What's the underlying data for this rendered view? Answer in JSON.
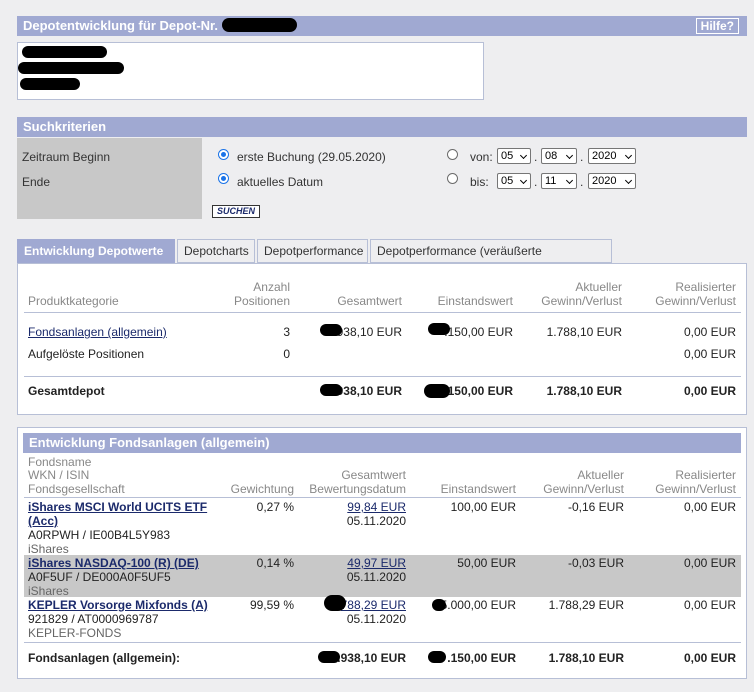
{
  "header": {
    "title": "Depotentwicklung für Depot-Nr.",
    "help_label": "Hilfe?"
  },
  "search": {
    "title": "Suchkriterien",
    "start_label": "Zeitraum Beginn",
    "end_label": "Ende",
    "opt_first_booking": "erste Buchung (29.05.2020)",
    "opt_current_date": "aktuelles Datum",
    "from_label": "von:",
    "to_label": "bis:",
    "from_day": "05",
    "from_month": "08",
    "from_year": "2020",
    "to_day": "05",
    "to_month": "11",
    "to_year": "2020",
    "dot": ".",
    "search_button": "SUCHEN"
  },
  "tabs": [
    "Entwicklung Depotwerte",
    "Depotcharts",
    "Depotperformance",
    "Depotperformance (veräußerte Positionen)"
  ],
  "summary": {
    "headers": {
      "category": "Produktkategorie",
      "count_l1": "Anzahl",
      "count_l2": "Positionen",
      "total": "Gesamtwert",
      "cost": "Einstandswert",
      "current_l1": "Aktueller",
      "current_l2": "Gewinn/Verlust",
      "realized_l1": "Realisierter",
      "realized_l2": "Gewinn/Verlust"
    },
    "rows": [
      {
        "category": "Fondsanlagen (allgemein)",
        "count": "3",
        "total": ".938,10 EUR",
        "cost": ".150,00 EUR",
        "current": "1.788,10 EUR",
        "realized": "0,00 EUR"
      },
      {
        "category": "Aufgelöste Positionen",
        "count": "0",
        "total": "",
        "cost": "",
        "current": "",
        "realized": "0,00 EUR"
      }
    ],
    "total_row": {
      "label": "Gesamtdepot",
      "total": ".938,10 EUR",
      "cost": ".150,00 EUR",
      "current": "1.788,10 EUR",
      "realized": "0,00 EUR"
    }
  },
  "funds": {
    "title": "Entwicklung Fondsanlagen (allgemein)",
    "headers": {
      "name_l1": "Fondsname",
      "name_l2": "WKN / ISIN",
      "name_l3": "Fondsgesellschaft",
      "weight": "Gewichtung",
      "total_l1": "Gesamtwert",
      "total_l2": "Bewertungsdatum",
      "cost": "Einstandswert",
      "current_l1": "Aktueller",
      "current_l2": "Gewinn/Verlust",
      "realized_l1": "Realisierter",
      "realized_l2": "Gewinn/Verlust"
    },
    "rows": [
      {
        "name_l1": "iShares MSCI World UCITS ETF",
        "name_l2": "(Acc)",
        "ids": "A0RPWH /  IE00B4L5Y983",
        "company": "iShares",
        "weight": "0,27 %",
        "total": "99,84 EUR",
        "date": "05.11.2020",
        "cost": "100,00 EUR",
        "current": "-0,16 EUR",
        "realized": "0,00 EUR"
      },
      {
        "name_l1": "iShares NASDAQ-100 (R) (DE)",
        "ids": "A0F5UF /  DE000A0F5UF5",
        "company": "iShares",
        "weight": "0,14 %",
        "total": "49,97 EUR",
        "date": "05.11.2020",
        "cost": "50,00 EUR",
        "current": "-0,03 EUR",
        "realized": "0,00 EUR"
      },
      {
        "name_l1": "KEPLER Vorsorge Mixfonds (A)",
        "ids": "921829 /  AT0000969787",
        "company": "KEPLER-FONDS",
        "weight": "99,59 %",
        "total": "788,29 EUR",
        "date": "05.11.2020",
        "cost": "5.000,00 EUR",
        "current": "1.788,29 EUR",
        "realized": "0,00 EUR"
      }
    ],
    "total_row": {
      "label": "Fondsanlagen (allgemein):",
      "total": ".938,10 EUR",
      "cost": ".150,00 EUR",
      "current": "1.788,10 EUR",
      "realized": "0,00 EUR"
    }
  }
}
